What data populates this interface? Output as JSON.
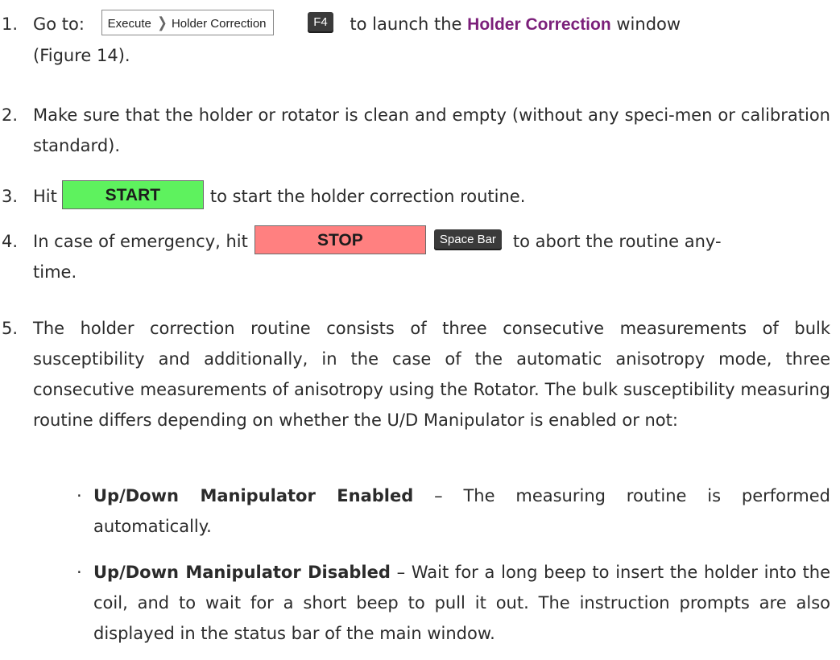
{
  "steps": [
    {
      "number": "1.",
      "pre": "Go to:",
      "menu_path": [
        "Execute",
        "Holder Correction"
      ],
      "shortcut": "F4",
      "mid": "to launch the",
      "highlight": "Holder Correction",
      "post": "window",
      "line2": "(Figure 14)."
    },
    {
      "number": "2.",
      "text": "Make sure that the holder or rotator is clean and empty (without any speci-men or calibration standard)."
    },
    {
      "number": "3.",
      "pre": "Hit",
      "button": "START",
      "post": "to start the holder correction routine."
    },
    {
      "number": "4.",
      "pre": "In case of emergency, hit",
      "button": "STOP",
      "shortcut": "Space Bar",
      "post": "to abort the routine any-",
      "line2": "time."
    },
    {
      "number": "5.",
      "text": "The holder correction routine consists of three consecutive measurements of bulk susceptibility and additionally, in the case of the automatic anisotropy mode, three consecutive measurements of anisotropy using the Rotator. The bulk susceptibility measuring routine differs depending on whether the U/D Manipulator is enabled or not:"
    }
  ],
  "bullets": [
    {
      "title": "Up/Down Manipulator Enabled",
      "text": "– The measuring routine is performed automatically."
    },
    {
      "title": "Up/Down Manipulator Disabled",
      "text": "– Wait for a long beep to insert the holder into the coil, and to wait for a short beep to pull it out. The instruction prompts are also displayed in the status bar of the main window."
    }
  ],
  "colors": {
    "highlight": "#7b1f7a",
    "start_button": "#5ef25e",
    "stop_button": "#ff8080",
    "key_background": "#3a3a3a"
  },
  "icons": {
    "menu_separator": "chevron-right-icon"
  }
}
